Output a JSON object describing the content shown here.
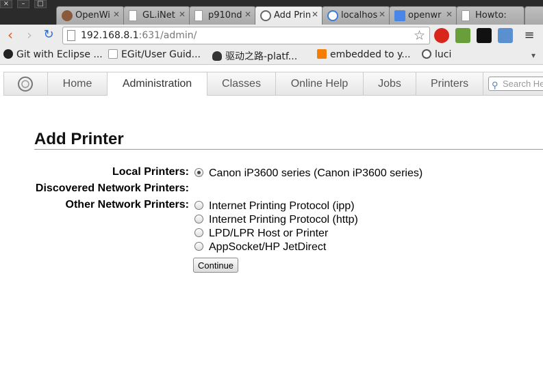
{
  "window": {
    "close_glyph": "×",
    "minimize_glyph": "–",
    "maximize_glyph": "□"
  },
  "tabs": [
    {
      "label": "OpenWi",
      "icon": "avatar-icon",
      "color": "#8a5a3c"
    },
    {
      "label": "GL.iNet",
      "icon": "page-icon",
      "color": "#999999"
    },
    {
      "label": "p910nd",
      "icon": "page-icon",
      "color": "#999999"
    },
    {
      "label": "Add Prin",
      "icon": "cups-icon",
      "color": "#666666"
    },
    {
      "label": "localhos",
      "icon": "ie-icon",
      "color": "#3a7bd5"
    },
    {
      "label": "openwr",
      "icon": "google-icon",
      "color": "#4a86e8"
    },
    {
      "label": "Howto: ",
      "icon": "page-icon",
      "color": "#999999"
    }
  ],
  "address": {
    "host": "192.168.8.1",
    "rest": ":631/admin/"
  },
  "bookmarks": [
    {
      "label": "Git with Eclipse ...",
      "icon": "github-icon",
      "color": "#222222"
    },
    {
      "label": "EGit/User Guid...",
      "icon": "page-icon",
      "color": "#bbbbbb"
    },
    {
      "label": "驱动之路-platf...",
      "icon": "penguin-icon",
      "color": "#333333"
    },
    {
      "label": "embedded to y...",
      "icon": "blogger-icon",
      "color": "#f57d00"
    },
    {
      "label": "luci",
      "icon": "openwrt-icon",
      "color": "#555555"
    }
  ],
  "cups_nav": {
    "items": [
      "Home",
      "Administration",
      "Classes",
      "Online Help",
      "Jobs",
      "Printers"
    ],
    "active": "Administration",
    "search_placeholder": "Search He"
  },
  "content": {
    "heading": "Add Printer",
    "local_label": "Local Printers:",
    "local_printers": [
      "Canon iP3600 series (Canon iP3600 series)"
    ],
    "discovered_label": "Discovered Network Printers:",
    "other_label": "Other Network Printers:",
    "other_printers": [
      "Internet Printing Protocol (ipp)",
      "Internet Printing Protocol (http)",
      "LPD/LPR Host or Printer",
      "AppSocket/HP JetDirect"
    ],
    "continue_label": "Continue"
  }
}
